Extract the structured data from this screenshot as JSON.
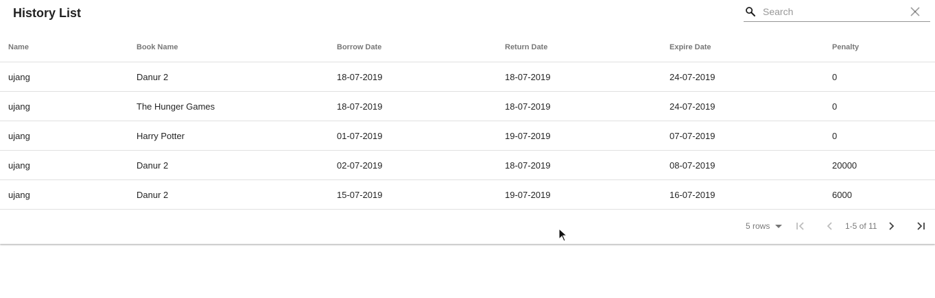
{
  "header": {
    "title": "History List",
    "search_placeholder": "Search",
    "search_value": ""
  },
  "table": {
    "columns": [
      "Name",
      "Book Name",
      "Borrow Date",
      "Return Date",
      "Expire Date",
      "Penalty"
    ],
    "rows": [
      [
        "ujang",
        "Danur 2",
        "18-07-2019",
        "18-07-2019",
        "24-07-2019",
        "0"
      ],
      [
        "ujang",
        "The Hunger Games",
        "18-07-2019",
        "18-07-2019",
        "24-07-2019",
        "0"
      ],
      [
        "ujang",
        "Harry Potter",
        "01-07-2019",
        "19-07-2019",
        "07-07-2019",
        "0"
      ],
      [
        "ujang",
        "Danur 2",
        "02-07-2019",
        "18-07-2019",
        "08-07-2019",
        "20000"
      ],
      [
        "ujang",
        "Danur 2",
        "15-07-2019",
        "19-07-2019",
        "16-07-2019",
        "6000"
      ]
    ]
  },
  "pagination": {
    "rows_per_page_label": "5 rows",
    "range_label": "1-5 of 11"
  },
  "icons": {
    "search": "search-icon",
    "clear": "close-icon",
    "rows_dropdown": "arrow-drop-down-icon",
    "first_page": "first-page-icon",
    "previous_page": "chevron-left-icon",
    "next_page": "chevron-right-icon",
    "last_page": "last-page-icon",
    "cursor": "mouse-pointer-icon"
  }
}
